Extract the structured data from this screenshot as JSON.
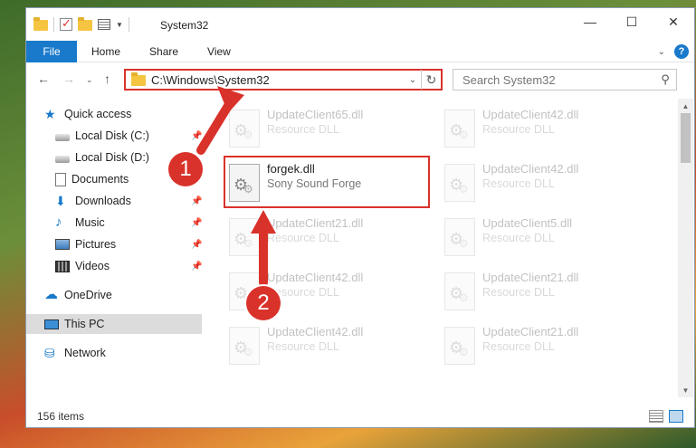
{
  "window": {
    "title": "System32"
  },
  "window_controls": {
    "minimize": "—",
    "maximize": "☐",
    "close": "✕"
  },
  "ribbon": {
    "file": "File",
    "tabs": [
      "Home",
      "Share",
      "View"
    ]
  },
  "address_bar": {
    "path": "C:\\Windows\\System32"
  },
  "search": {
    "placeholder": "Search System32"
  },
  "sidebar": {
    "items": [
      {
        "label": "Quick access",
        "icon": "star-icon",
        "pinned": false
      },
      {
        "label": "Local Disk (C:)",
        "icon": "disk-icon",
        "pinned": true
      },
      {
        "label": "Local Disk (D:)",
        "icon": "disk-icon",
        "pinned": false
      },
      {
        "label": "Documents",
        "icon": "documents-icon",
        "pinned": false
      },
      {
        "label": "Downloads",
        "icon": "download-icon",
        "pinned": true
      },
      {
        "label": "Music",
        "icon": "music-icon",
        "pinned": true
      },
      {
        "label": "Pictures",
        "icon": "pictures-icon",
        "pinned": true
      },
      {
        "label": "Videos",
        "icon": "videos-icon",
        "pinned": true
      },
      {
        "label": "OneDrive",
        "icon": "cloud-icon",
        "pinned": false
      },
      {
        "label": "This PC",
        "icon": "pc-icon",
        "pinned": false,
        "selected": true
      },
      {
        "label": "Network",
        "icon": "network-icon",
        "pinned": false
      }
    ]
  },
  "files": [
    {
      "name": "UpdateClient65.dll",
      "type": "Resource DLL",
      "faded": true
    },
    {
      "name": "UpdateClient42.dll",
      "type": "Resource DLL",
      "faded": true
    },
    {
      "name": "forgek.dll",
      "type": "Sony Sound Forge",
      "faded": false,
      "highlighted": true
    },
    {
      "name": "UpdateClient42.dll",
      "type": "Resource DLL",
      "faded": true
    },
    {
      "name": "UpdateClient21.dll",
      "type": "Resource DLL",
      "faded": true
    },
    {
      "name": "UpdateClient5.dll",
      "type": "Resource DLL",
      "faded": true
    },
    {
      "name": "UpdateClient42.dll",
      "type": "Resource DLL",
      "faded": true
    },
    {
      "name": "UpdateClient21.dll",
      "type": "Resource DLL",
      "faded": true
    },
    {
      "name": "UpdateClient42.dll",
      "type": "Resource DLL",
      "faded": true
    },
    {
      "name": "UpdateClient21.dll",
      "type": "Resource DLL",
      "faded": true
    }
  ],
  "status": {
    "item_count": "156 items"
  },
  "annotations": {
    "step1": "1",
    "step2": "2",
    "color": "#d9322b"
  }
}
